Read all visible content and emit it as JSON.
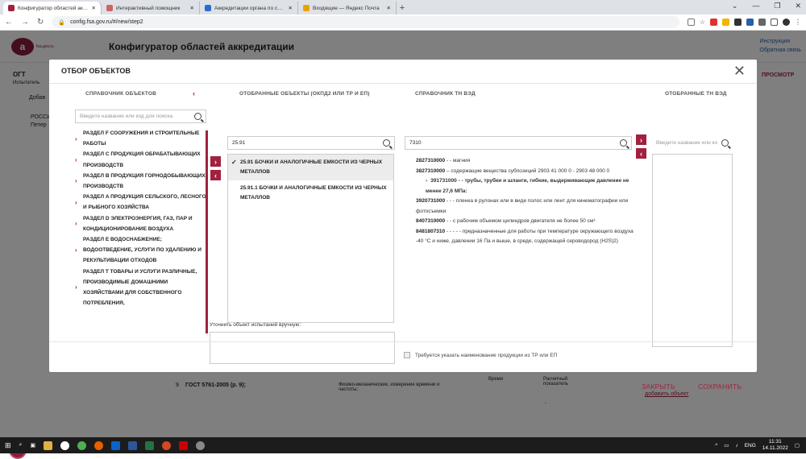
{
  "browser": {
    "tabs": [
      {
        "label": "Конфигуратор областей аккреди",
        "color": "#a0223f"
      },
      {
        "label": "Интерактивный помощник",
        "color": "#c66"
      },
      {
        "label": "Аккредитации органа по серти",
        "color": "#2a6dd1"
      },
      {
        "label": "Входящие — Яндекс Почта",
        "color": "#e8a300"
      }
    ],
    "url": "config.fsa.gov.ru/#/new/step2"
  },
  "site": {
    "logo_text": "fsa.gov.ru",
    "logo_letter": "а",
    "title": "Конфигуратор областей аккредитации",
    "link_instruction": "Инструкция",
    "link_feedback": "Обратная связь",
    "bg_left": "ОГТ",
    "bg_left_sub": "Испытатель",
    "bg_add": "Добав",
    "bg_russia": "РОССИ",
    "bg_peter": "Петер",
    "bg_view": "ПРОСМОТР",
    "bg_row_no": "9",
    "bg_row_gost": "ГОСТ 5761-2005 (р. 9);",
    "bg_row_method": "Физико-механические, измерение времени и частоты;",
    "bg_row_time": "Время",
    "bg_row_calc": "Расчетный показатель",
    "bg_row_dash": "-",
    "bg_add_object": "добавить объект"
  },
  "modal": {
    "title": "ОТБОР ОБЪЕКТОВ",
    "col1_header": "СПРАВОЧНИК ОБЪЕКТОВ",
    "col1_search_placeholder": "Введите название или код для поиска",
    "tree": [
      "РАЗДЕЛ F СООРУЖЕНИЯ И СТРОИТЕЛЬНЫЕ РАБОТЫ",
      "РАЗДЕЛ C ПРОДУКЦИЯ ОБРАБАТЫВАЮЩИХ ПРОИЗВОДСТВ",
      "РАЗДЕЛ B ПРОДУКЦИЯ ГОРНОДОБЫВАЮЩИХ ПРОИЗВОДСТВ",
      "РАЗДЕЛ A ПРОДУКЦИЯ СЕЛЬСКОГО, ЛЕСНОГО И РЫБНОГО ХОЗЯЙСТВА",
      "РАЗДЕЛ D ЭЛЕКТРОЭНЕРГИЯ, ГАЗ, ПАР И КОНДИЦИОНИРОВАНИЕ ВОЗДУХА",
      "РАЗДЕЛ E ВОДОСНАБЖЕНИЕ; ВОДООТВЕДЕНИЕ, УСЛУГИ ПО УДАЛЕНИЮ И РЕКУЛЬТИВАЦИИ ОТХОДОВ",
      "РАЗДЕЛ T ТОВАРЫ И УСЛУГИ РАЗЛИЧНЫЕ, ПРОИЗВОДИМЫЕ ДОМАШНИМИ ХОЗЯЙСТВАМИ ДЛЯ СОБСТВЕННОГО ПОТРЕБЛЕНИЯ,"
    ],
    "col2_header": "ОТОБРАННЫЕ ОБЪЕКТЫ (ОКПД2 ИЛИ ТР И ЕП)",
    "col2_search_value": "25.91",
    "selected": [
      {
        "label": "25.91 БОЧКИ И АНАЛОГИЧНЫЕ ЕМКОСТИ ИЗ ЧЕРНЫХ МЕТАЛЛОВ",
        "checked": true
      },
      {
        "label": "25.91.1 БОЧКИ И АНАЛОГИЧНЫЕ ЕМКОСТИ ИЗ ЧЕРНЫХ МЕТАЛЛОВ",
        "checked": false
      }
    ],
    "manual_label": "Уточнить объект испытаний вручную:",
    "col3_header": "СПРАВОЧНИК ТН ВЭД",
    "col3_search_value": "7310",
    "tnved": [
      {
        "code": "2827310000",
        "text": " - - магния",
        "sub": false
      },
      {
        "code": "3827310000",
        "text": " – содержащие вещества субпозиций 2903 41 000 0 - 2903 48 000 0",
        "sub": false
      },
      {
        "code": "391731000",
        "text": " - - трубы, трубки и шланги, гибкие, выдерживающие давление не менее 27,6 МПа:",
        "sub": true
      },
      {
        "code": "3920731000",
        "text": " - - - пленка в рулонах или в виде полос или лент для кинематографии или фотосъемки",
        "sub": false
      },
      {
        "code": "8407310000",
        "text": " - - с рабочим объемом цилиндров двигателя не более 50 см³",
        "sub": false
      },
      {
        "code": "8481807310",
        "text": " - - - - - предназначенные для работы при температуре окружающего воздуха -40 °С и ниже, давлении 16 Па и выше, в среде, содержащей сероводород (H2S)2)",
        "sub": false
      }
    ],
    "required_label": "Требуется указать наименование продукции из ТР или ЕП",
    "col4_header": "ОТОБРАННЫЕ ТН ВЭД",
    "col4_search_placeholder": "Введите название или ко",
    "close_label": "ЗАКРЫТЬ",
    "save_label": "СОХРАНИТЬ"
  },
  "taskbar": {
    "lang": "ENG",
    "time": "11:31",
    "date": "14.11.2022"
  },
  "colors": {
    "accent": "#a0223f"
  }
}
